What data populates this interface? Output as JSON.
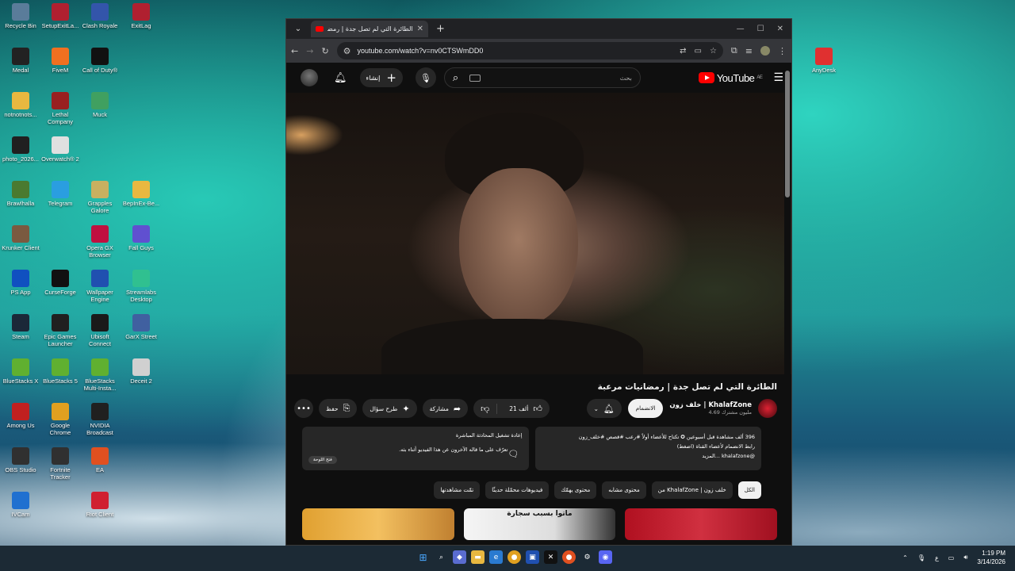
{
  "desktop_icons": [
    {
      "label": "Recycle Bin",
      "icon": "recycle-bin-icon",
      "color": "#5a7c9a"
    },
    {
      "label": "SetupExitLa...",
      "icon": "exitlag-icon",
      "color": "#b02030"
    },
    {
      "label": "Clash Royale",
      "icon": "clash-royale-icon",
      "color": "#3355aa"
    },
    {
      "label": "ExitLag",
      "icon": "exitlag-icon",
      "color": "#b02030"
    },
    {
      "label": "Medal",
      "icon": "medal-icon",
      "color": "#222222"
    },
    {
      "label": "FiveM",
      "icon": "fivem-icon",
      "color": "#f07020"
    },
    {
      "label": "Call of Duty®",
      "icon": "cod-icon",
      "color": "#111111"
    },
    {
      "label": "notnotnots...",
      "icon": "folder-icon",
      "color": "#e8b840"
    },
    {
      "label": "Lethal Company",
      "icon": "lethal-company-icon",
      "color": "#992020"
    },
    {
      "label": "Muck",
      "icon": "muck-icon",
      "color": "#40a060"
    },
    {
      "label": "photo_2026...",
      "icon": "photo-icon",
      "color": "#202020"
    },
    {
      "label": "Overwatch® 2",
      "icon": "overwatch-icon",
      "color": "#e0e0e0"
    },
    {
      "label": "Brawlhalla",
      "icon": "brawlhalla-icon",
      "color": "#4a7a30"
    },
    {
      "label": "Telegram",
      "icon": "telegram-icon",
      "color": "#2a9ee0"
    },
    {
      "label": "Grapples Galore",
      "icon": "grapples-icon",
      "color": "#c8b060"
    },
    {
      "label": "BepInEx-Be...",
      "icon": "folder-icon",
      "color": "#e8b840"
    },
    {
      "label": "Krunker Client",
      "icon": "krunker-icon",
      "color": "#7a5a40"
    },
    {
      "label": "Opera GX Browser",
      "icon": "opera-gx-icon",
      "color": "#c01040"
    },
    {
      "label": "Fall Guys",
      "icon": "fall-guys-icon",
      "color": "#6050d0"
    },
    {
      "label": "PS App",
      "icon": "ps-app-icon",
      "color": "#1050c0"
    },
    {
      "label": "CurseForge",
      "icon": "curseforge-icon",
      "color": "#111111"
    },
    {
      "label": "Wallpaper Engine",
      "icon": "wallpaper-engine-icon",
      "color": "#2050b0"
    },
    {
      "label": "Streamlabs Desktop",
      "icon": "streamlabs-icon",
      "color": "#30c090"
    },
    {
      "label": "Steam",
      "icon": "steam-icon",
      "color": "#1b2838"
    },
    {
      "label": "Epic Games Launcher",
      "icon": "epic-games-icon",
      "color": "#202020"
    },
    {
      "label": "Ubisoft Connect",
      "icon": "ubisoft-icon",
      "color": "#1a1a1a"
    },
    {
      "label": "GarX Street",
      "icon": "garx-icon",
      "color": "#4060a0"
    },
    {
      "label": "BlueStacks X",
      "icon": "bluestacks-x-icon",
      "color": "#60b030"
    },
    {
      "label": "BlueStacks 5",
      "icon": "bluestacks-icon",
      "color": "#60b030"
    },
    {
      "label": "BlueStacks Multi-Insta...",
      "icon": "bluestacks-multi-icon",
      "color": "#60b030"
    },
    {
      "label": "Deceit 2",
      "icon": "deceit-icon",
      "color": "#d0d0d0"
    },
    {
      "label": "Among Us",
      "icon": "among-us-icon",
      "color": "#c02020"
    },
    {
      "label": "Google Chrome",
      "icon": "chrome-icon",
      "color": "#e0a020"
    },
    {
      "label": "NVIDIA Broadcast",
      "icon": "nvidia-icon",
      "color": "#202020"
    },
    {
      "label": "OBS Studio",
      "icon": "obs-icon",
      "color": "#303030"
    },
    {
      "label": "Fortnite Tracker",
      "icon": "fortnite-tracker-icon",
      "color": "#303030"
    },
    {
      "label": "EA",
      "icon": "ea-icon",
      "color": "#e05020"
    },
    {
      "label": "IVCam",
      "icon": "ivcam-icon",
      "color": "#2070d0"
    },
    {
      "label": "Riot Client",
      "icon": "riot-client-icon",
      "color": "#d02030"
    },
    {
      "label": "AnyDesk",
      "icon": "anydesk-icon",
      "color": "#e03030"
    }
  ],
  "browser": {
    "tab_title": "الطائرة التي لم تصل جدة | رمضانيات",
    "url": "youtube.com/watch?v=nv0CTSWmDD0"
  },
  "youtube": {
    "create_label": "إنشاء",
    "search_placeholder": "بحث",
    "logo_text": "YouTube",
    "region": "AE",
    "video_title": "الطائرة التي لم تصل جدة | رمضانيات مرعبة",
    "channel_name": "خلف زون | KhalafZone",
    "subscribers": "4.69 مليون مشترك",
    "join_label": "الانضمام",
    "likes": "21 ألف",
    "share_label": "مشاركة",
    "ask_label": "طرح سؤال",
    "save_label": "حفظ",
    "desc_line1": "396 ألف مشاهدة قبل أسبوعين ✪ تكتاح للأعضاء أولاً #رعب #قصص #خلف_زون",
    "desc_line2": "رابط الانضمام لأعضاء القناة (اضغط)",
    "desc_line3": "@khalafzone ...المزيد",
    "chat_title": "إعادة تشغيل المحادثة المباشرة",
    "chat_text": "تعرّف على ما قاله الآخرون عن هذا الفيديو أثناء بثه.",
    "chat_open": "فتح اللوحة",
    "chips": [
      "الكل",
      "من KhalafZone | خلف زون",
      "محتوى مشابه",
      "محتوى يهمّك",
      "فيديوهات محمّلة حديثًا",
      "تمّت مشاهدتها"
    ],
    "thumb_captions": [
      "",
      "ماتوا بسبب سجارة",
      ""
    ]
  },
  "taskbar": {
    "lang": "ع",
    "time": "1:19 PM",
    "date": "3/14/2026"
  },
  "colors": {
    "yt_red": "#ff0000",
    "accent_link": "#3ea6ff"
  }
}
